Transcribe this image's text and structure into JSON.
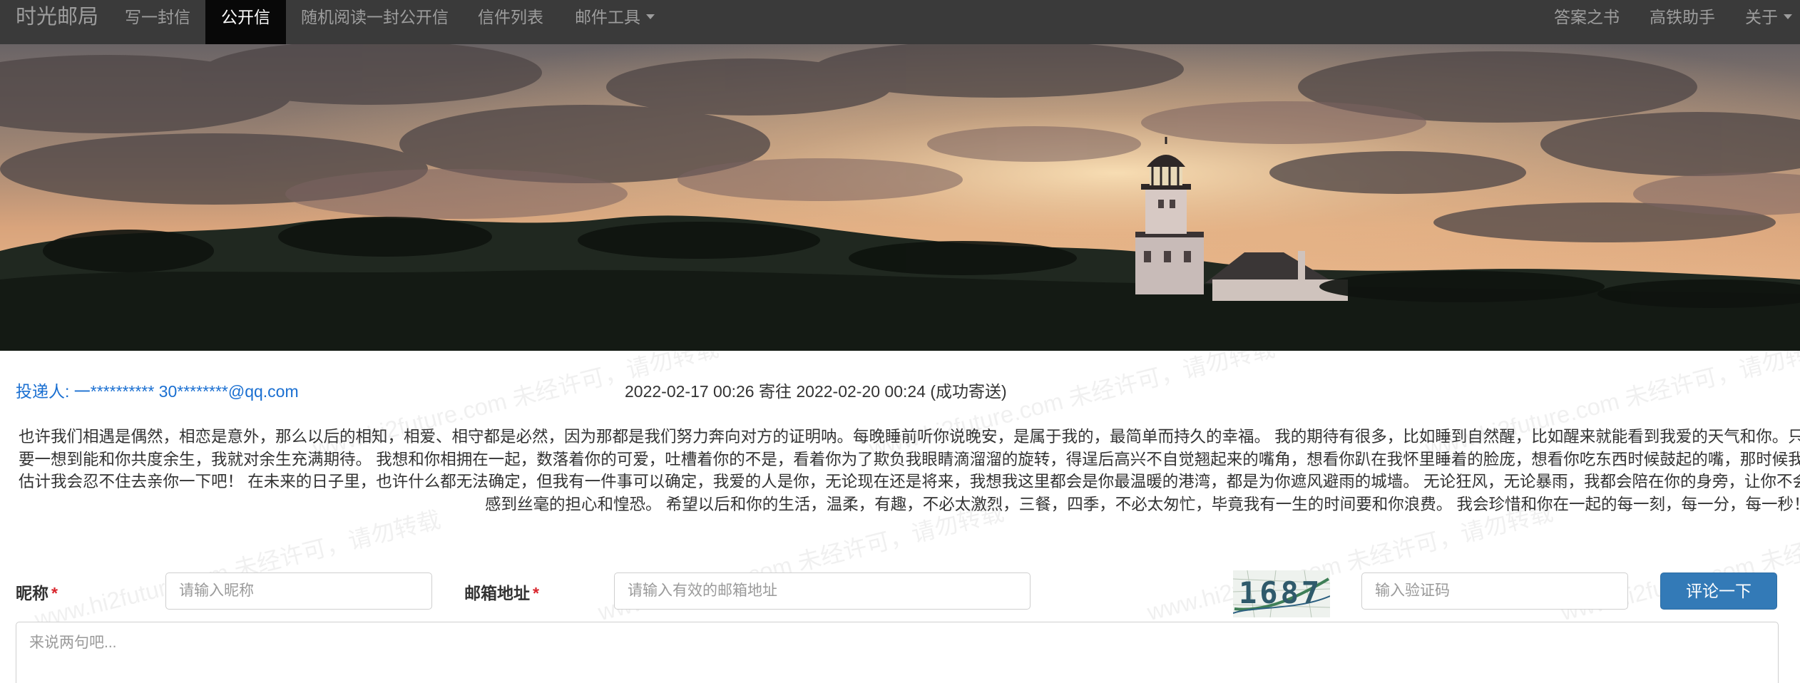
{
  "nav": {
    "brand": "时光邮局",
    "items": [
      "写一封信",
      "公开信",
      "随机阅读一封公开信",
      "信件列表",
      "邮件工具"
    ],
    "active_index": 1,
    "right_items": [
      "答案之书",
      "高铁助手",
      "关于"
    ]
  },
  "letter": {
    "sender": "投递人: 一********** 30********@qq.com",
    "dates": "2022-02-17 00:26 寄往 2022-02-20 00:24 (成功寄送)",
    "lines": [
      "也许我们相遇是偶然，相恋是意外，那么以后的相知，相爱、相守都是必然，因为那都是我们努力奔向对方的证明呐。每晚睡前听你说晚安，是属于我的，最简单而持久的幸福。 我的期待有很多，比如睡到自然醒，比如醒来就能看到我爱的天气和你。只",
      "要一想到能和你共度余生，我就对余生充满期待。 我想和你相拥在一起，数落着你的可爱，吐槽着你的不是，看着你为了欺负我眼睛滴溜溜的旋转，得逞后高兴不自觉翘起来的嘴角，想看你趴在我怀里睡着的脸庞，想看你吃东西时候鼓起的嘴，那时候我",
      "估计我会忍不住去亲你一下吧！ 在未来的日子里，也许什么都无法确定，但我有一件事可以确定，我爱的人是你，无论现在还是将来，我想我这里都会是你最温暖的港湾，都是为你遮风避雨的城墙。 无论狂风，无论暴雨，我都会陪在你的身旁，让你不会",
      "感到丝毫的担心和惶恐。 希望以后和你的生活，温柔，有趣，不必太激烈，三餐，四季，不必太匆忙，毕竟我有一生的时间要和你浪费。 我会珍惜和你在一起的每一刻，每一分，每一秒！"
    ]
  },
  "watermark": "www.hi2future.com 未经许可，请勿转载",
  "comment_form": {
    "nickname_label": "昵称",
    "nickname_placeholder": "请输入昵称",
    "email_label": "邮箱地址",
    "email_placeholder": "请输入有效的邮箱地址",
    "required_mark": "*",
    "captcha_text": "1687",
    "captcha_placeholder": "输入验证码",
    "submit_label": "评论一下",
    "content_placeholder": "来说两句吧..."
  },
  "colors": {
    "navbar_bg": "#3a3a3a",
    "active_tab_bg": "#080808",
    "link_blue": "#1a6fd1",
    "button_blue": "#337ab7",
    "required_red": "#d9272e"
  }
}
